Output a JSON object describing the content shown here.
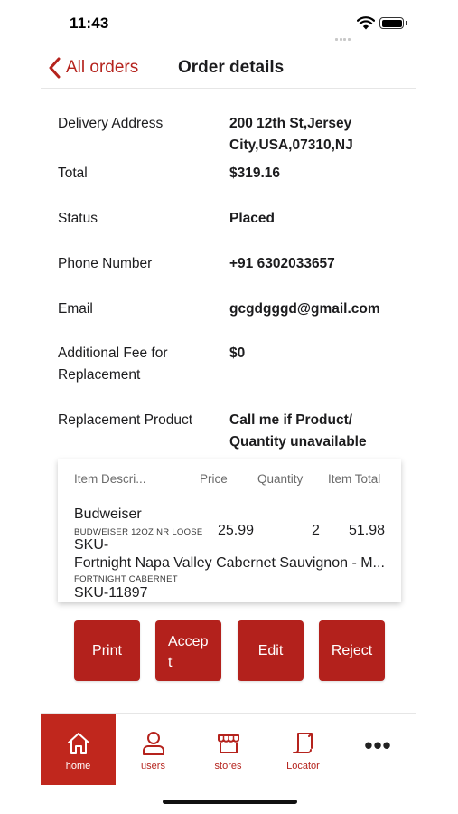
{
  "status_bar": {
    "time": "11:43"
  },
  "nav": {
    "back_label": "All orders",
    "title": "Order details"
  },
  "details": [
    {
      "label": "Delivery Address",
      "value": "200 12th St,Jersey City,USA,07310,NJ"
    },
    {
      "label": "Total",
      "value": "$319.16"
    },
    {
      "label": "Status",
      "value": "Placed"
    },
    {
      "label": "Phone Number",
      "value": "+91 6302033657"
    },
    {
      "label": "Email",
      "value": "gcgdgggd@gmail.com"
    },
    {
      "label": "Additional Fee for Replacement",
      "value": "$0"
    },
    {
      "label": "Replacement Product",
      "value": "Call me if Product/ Quantity unavailable"
    }
  ],
  "items_table": {
    "columns": [
      "Item Descri...",
      "Price",
      "Quantity",
      "Item Total"
    ],
    "rows": [
      {
        "name": "Budweiser",
        "sub": "BUDWEISER 12OZ NR LOOSE",
        "sku": "SKU-",
        "price": "25.99",
        "quantity": "2",
        "total": "51.98"
      },
      {
        "name": "Fortnight Napa Valley Cabernet Sauvignon - M...",
        "sub": "FORTNIGHT CABERNET",
        "sku": "SKU-11897",
        "price": "",
        "quantity": "",
        "total": ""
      }
    ]
  },
  "actions": {
    "print": "Print",
    "accept": "Accep\nt",
    "edit": "Edit",
    "reject": "Reject"
  },
  "tabs": [
    {
      "label": "home",
      "icon": "home-icon",
      "active": true
    },
    {
      "label": "users",
      "icon": "user-icon",
      "active": false
    },
    {
      "label": "stores",
      "icon": "store-icon",
      "active": false
    },
    {
      "label": "Locator",
      "icon": "locator-icon",
      "active": false
    },
    {
      "label": "",
      "icon": "more-icon",
      "active": false
    }
  ],
  "colors": {
    "accent": "#b5231d",
    "button": "#b3211c",
    "active_tab": "#c0271d"
  }
}
